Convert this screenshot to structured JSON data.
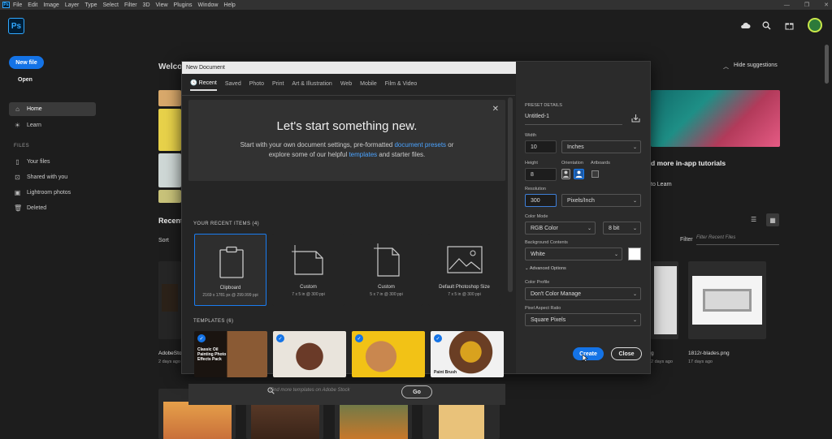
{
  "menubar": {
    "app_icon": "Ps",
    "items": [
      "File",
      "Edit",
      "Image",
      "Layer",
      "Type",
      "Select",
      "Filter",
      "3D",
      "View",
      "Plugins",
      "Window",
      "Help"
    ]
  },
  "topbar": {
    "logo": "Ps",
    "icons": [
      "cloud-icon",
      "search-icon",
      "gift-icon",
      "avatar"
    ]
  },
  "sidebar": {
    "new_file": "New file",
    "open": "Open",
    "nav": [
      {
        "label": "Home",
        "icon": "home-icon"
      },
      {
        "label": "Learn",
        "icon": "lightbulb-icon"
      }
    ],
    "files_header": "FILES",
    "files": [
      {
        "label": "Your files",
        "icon": "file-icon"
      },
      {
        "label": "Shared with you",
        "icon": "shared-icon"
      },
      {
        "label": "Lightroom photos",
        "icon": "lightroom-icon"
      },
      {
        "label": "Deleted",
        "icon": "trash-icon"
      }
    ]
  },
  "home": {
    "welcome": "Welcom",
    "hide_suggestions": "Hide suggestions",
    "recent": "Recent",
    "sort": "Sort",
    "filter_label": "Filter",
    "filter_placeholder": "Filter Recent Files",
    "tutorials_title": "d more in-app tutorials",
    "tutorials_link": "to Learn",
    "files": [
      {
        "name": "AdobeSto",
        "date": "2 days ago"
      },
      {
        "name": "g",
        "date": "2 days ago"
      },
      {
        "name": "1812r-blades.png",
        "date": "17 days ago"
      }
    ]
  },
  "dialog": {
    "title": "New Document",
    "tabs": [
      "Recent",
      "Saved",
      "Photo",
      "Print",
      "Art & Illustration",
      "Web",
      "Mobile",
      "Film & Video"
    ],
    "banner": {
      "heading": "Let's start something new.",
      "line1_pre": "Start with your own document settings, pre-formatted ",
      "line1_link": "document presets",
      "line1_post": " or",
      "line2_pre": "explore some of our helpful ",
      "line2_link": "templates",
      "line2_post": " and starter files."
    },
    "recent_header": "YOUR RECENT ITEMS  (4)",
    "recent_items": [
      {
        "name": "Clipboard",
        "size": "2169 x 1781 px @ 299.999 ppi"
      },
      {
        "name": "Custom",
        "size": "7 x 5 in @ 300 ppi"
      },
      {
        "name": "Custom",
        "size": "5 x 7 in @ 300 ppi"
      },
      {
        "name": "Default Photoshop Size",
        "size": "7 x 5 in @ 300 ppi"
      }
    ],
    "templates_header": "TEMPLATES  (6)",
    "templates": [
      {
        "caption": "Classic Oil Painting Photo Effects Pack"
      },
      {
        "caption": ""
      },
      {
        "caption": ""
      },
      {
        "caption": "Paint Brush"
      }
    ],
    "search_placeholder": "Find more templates on Adobe Stock",
    "go": "Go",
    "preset": {
      "header": "PRESET DETAILS",
      "name": "Untitled-1",
      "width_label": "Width",
      "width": "10",
      "width_unit": "Inches",
      "height_label": "Height",
      "height": "8",
      "orientation_label": "Orientation",
      "artboards_label": "Artboards",
      "resolution_label": "Resolution",
      "resolution": "300",
      "resolution_unit": "Pixels/Inch",
      "color_mode_label": "Color Mode",
      "color_mode": "RGB Color",
      "bit_depth": "8 bit",
      "bg_label": "Background Contents",
      "bg": "White",
      "advanced": "Advanced Options",
      "profile_label": "Color Profile",
      "profile": "Don't Color Manage",
      "pixel_aspect_label": "Pixel Aspect Ratio",
      "pixel_aspect": "Square Pixels"
    },
    "create": "Create",
    "close": "Close"
  },
  "colors": {
    "accent": "#1473e6",
    "bg": "#1d1d1d",
    "dialog": "#252525"
  }
}
